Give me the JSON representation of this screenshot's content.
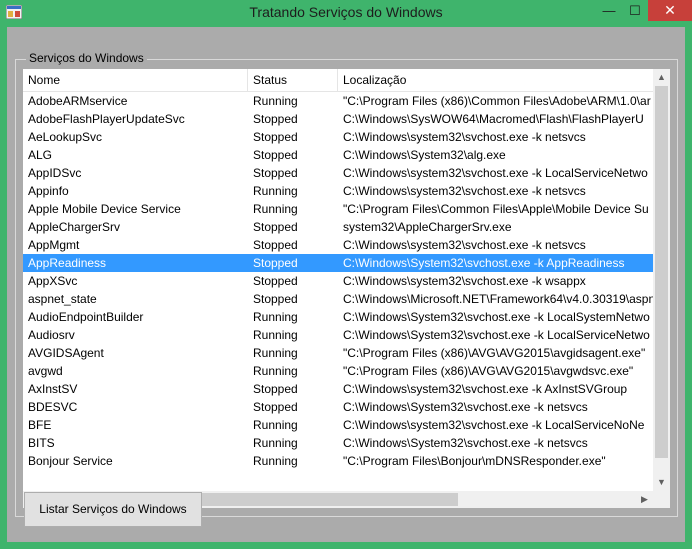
{
  "window": {
    "title": "Tratando Serviços do Windows"
  },
  "titlebar_buttons": {
    "minimize": "—",
    "maximize": "☐",
    "close": "✕"
  },
  "groupbox": {
    "label": "Serviços do Windows"
  },
  "columns": [
    "Nome",
    "Status",
    "Localização"
  ],
  "rows": [
    {
      "name": "AdobeARMservice",
      "status": "Running",
      "location": "\"C:\\Program Files (x86)\\Common Files\\Adobe\\ARM\\1.0\\ar"
    },
    {
      "name": "AdobeFlashPlayerUpdateSvc",
      "status": "Stopped",
      "location": "C:\\Windows\\SysWOW64\\Macromed\\Flash\\FlashPlayerU"
    },
    {
      "name": "AeLookupSvc",
      "status": "Stopped",
      "location": "C:\\Windows\\system32\\svchost.exe -k netsvcs"
    },
    {
      "name": "ALG",
      "status": "Stopped",
      "location": "C:\\Windows\\System32\\alg.exe"
    },
    {
      "name": "AppIDSvc",
      "status": "Stopped",
      "location": "C:\\Windows\\system32\\svchost.exe -k LocalServiceNetwo"
    },
    {
      "name": "Appinfo",
      "status": "Running",
      "location": "C:\\Windows\\system32\\svchost.exe -k netsvcs"
    },
    {
      "name": "Apple Mobile Device Service",
      "status": "Running",
      "location": "\"C:\\Program Files\\Common Files\\Apple\\Mobile Device Su"
    },
    {
      "name": "AppleChargerSrv",
      "status": "Stopped",
      "location": "system32\\AppleChargerSrv.exe"
    },
    {
      "name": "AppMgmt",
      "status": "Stopped",
      "location": "C:\\Windows\\system32\\svchost.exe -k netsvcs"
    },
    {
      "name": "AppReadiness",
      "status": "Stopped",
      "location": "C:\\Windows\\System32\\svchost.exe -k AppReadiness",
      "selected": true
    },
    {
      "name": "AppXSvc",
      "status": "Stopped",
      "location": "C:\\Windows\\system32\\svchost.exe -k wsappx"
    },
    {
      "name": "aspnet_state",
      "status": "Stopped",
      "location": "C:\\Windows\\Microsoft.NET\\Framework64\\v4.0.30319\\aspn"
    },
    {
      "name": "AudioEndpointBuilder",
      "status": "Running",
      "location": "C:\\Windows\\System32\\svchost.exe -k LocalSystemNetwo"
    },
    {
      "name": "Audiosrv",
      "status": "Running",
      "location": "C:\\Windows\\System32\\svchost.exe -k LocalServiceNetwo"
    },
    {
      "name": "AVGIDSAgent",
      "status": "Running",
      "location": "\"C:\\Program Files (x86)\\AVG\\AVG2015\\avgidsagent.exe\""
    },
    {
      "name": "avgwd",
      "status": "Running",
      "location": "\"C:\\Program Files (x86)\\AVG\\AVG2015\\avgwdsvc.exe\""
    },
    {
      "name": "AxInstSV",
      "status": "Stopped",
      "location": "C:\\Windows\\system32\\svchost.exe -k AxInstSVGroup"
    },
    {
      "name": "BDESVC",
      "status": "Stopped",
      "location": "C:\\Windows\\System32\\svchost.exe -k netsvcs"
    },
    {
      "name": "BFE",
      "status": "Running",
      "location": "C:\\Windows\\system32\\svchost.exe -k LocalServiceNoNe"
    },
    {
      "name": "BITS",
      "status": "Running",
      "location": "C:\\Windows\\System32\\svchost.exe -k netsvcs"
    },
    {
      "name": "Bonjour Service",
      "status": "Running",
      "location": "\"C:\\Program Files\\Bonjour\\mDNSResponder.exe\""
    }
  ],
  "button": {
    "list_label": "Listar Serviços do Windows"
  },
  "colors": {
    "window_frame": "#3fb46c",
    "client_bg": "#ababab",
    "selection": "#3399ff",
    "close_button": "#c7403a"
  }
}
